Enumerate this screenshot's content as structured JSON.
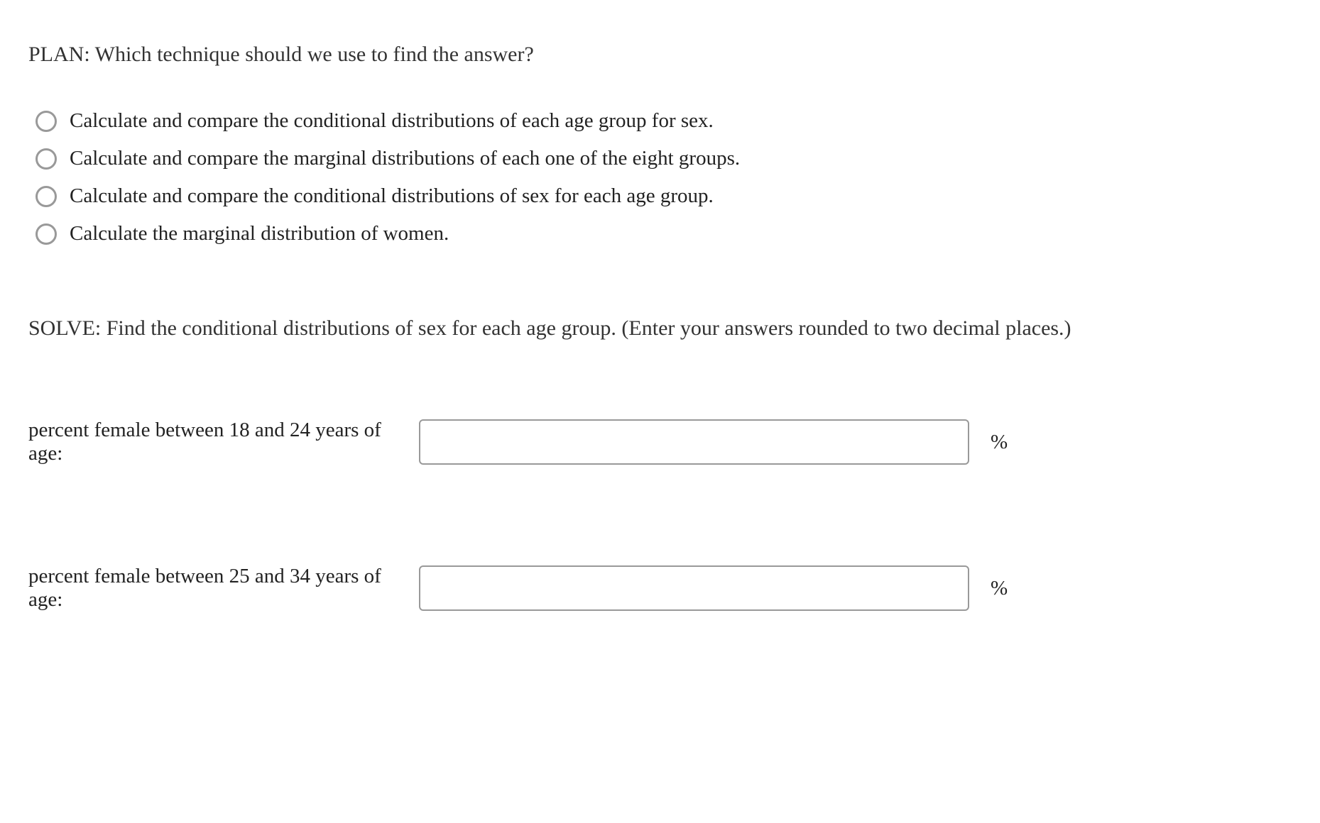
{
  "plan": {
    "prompt": "PLAN: Which technique should we use to find the answer?",
    "options": [
      "Calculate and compare the conditional distributions of each age group for sex.",
      "Calculate and compare the marginal distributions of each one of the eight groups.",
      "Calculate and compare the conditional distributions of sex for each age group.",
      "Calculate the marginal distribution of women."
    ]
  },
  "solve": {
    "prompt": "SOLVE: Find the conditional distributions of sex for each age group. (Enter your answers rounded to two decimal places.)",
    "answers": [
      {
        "label": "percent female between 18 and 24 years of age:",
        "value": "",
        "unit": "%"
      },
      {
        "label": "percent female between 25 and 34 years of age:",
        "value": "",
        "unit": "%"
      }
    ]
  }
}
